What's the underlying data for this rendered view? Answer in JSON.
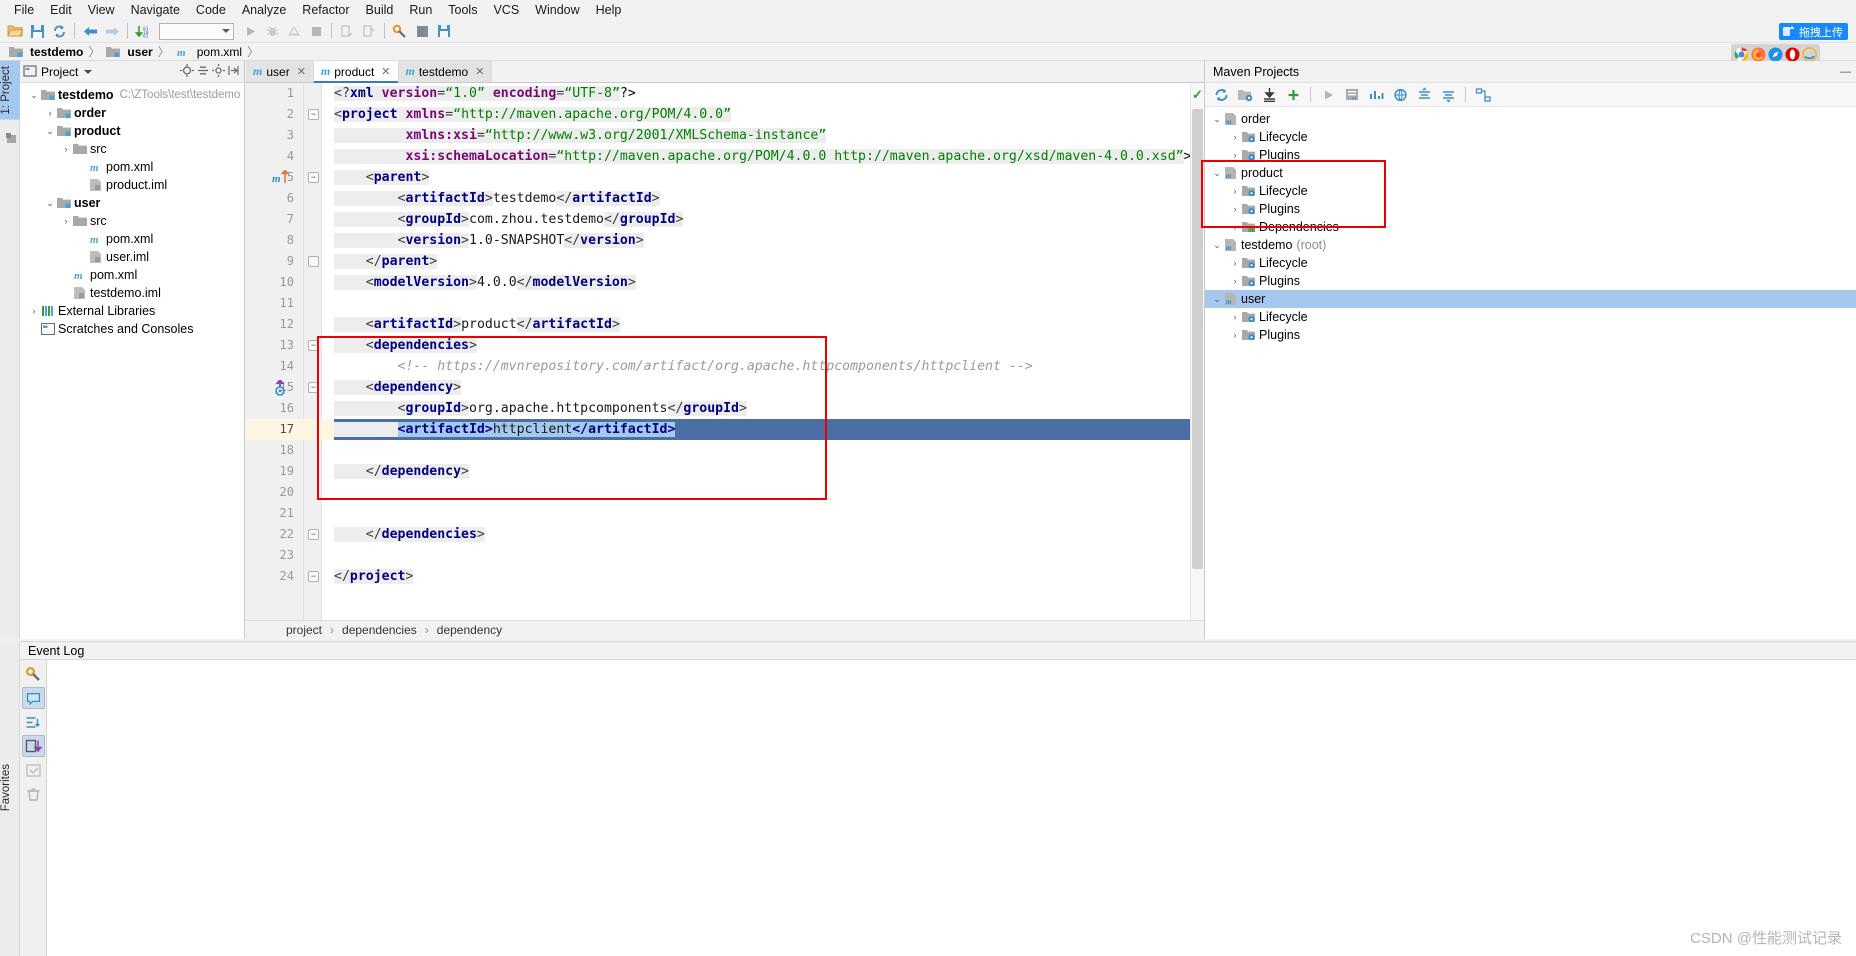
{
  "menu": {
    "items": [
      "File",
      "Edit",
      "View",
      "Navigate",
      "Code",
      "Analyze",
      "Refactor",
      "Build",
      "Run",
      "Tools",
      "VCS",
      "Window",
      "Help"
    ]
  },
  "toolbar": {
    "upload_label": "拖拽上传",
    "combo_value": "",
    "icons": [
      "open-folder-icon",
      "save-icon",
      "sync-icon",
      "back-arrow-icon",
      "forward-arrow-icon",
      "update-project-icon",
      "run-icon",
      "debug-icon",
      "coverage-icon",
      "stop-icon",
      "profile-icon",
      "attach-icon",
      "settings-wrench-icon",
      "project-structure-icon",
      "save-all-icon"
    ]
  },
  "breadcrumb": {
    "items": [
      {
        "label": "testdemo",
        "icon": "module-icon",
        "bold": true
      },
      {
        "label": "user",
        "icon": "module-icon",
        "bold": true
      },
      {
        "label": "pom.xml",
        "icon": "maven-m-icon",
        "bold": false
      }
    ],
    "separator": "〉"
  },
  "left_rail": {
    "tabs": [
      {
        "label": "1: Project",
        "selected": true
      },
      {
        "label": "",
        "selected": false
      }
    ],
    "favorites_label": "Favorites"
  },
  "project_panel": {
    "title": "Project",
    "tree": [
      {
        "depth": 0,
        "arrow": "⌄",
        "icon": "module-icon",
        "label": "testdemo",
        "bold": true,
        "path": "C:\\ZTools\\test\\testdemo"
      },
      {
        "depth": 1,
        "arrow": "›",
        "icon": "module-icon",
        "label": "order",
        "bold": true,
        "path": ""
      },
      {
        "depth": 1,
        "arrow": "⌄",
        "icon": "module-icon",
        "label": "product",
        "bold": true,
        "path": ""
      },
      {
        "depth": 2,
        "arrow": "›",
        "icon": "folder-icon",
        "label": "src",
        "bold": false,
        "path": ""
      },
      {
        "depth": 3,
        "arrow": "",
        "icon": "maven-m-icon",
        "label": "pom.xml",
        "bold": false,
        "path": ""
      },
      {
        "depth": 3,
        "arrow": "",
        "icon": "iml-icon",
        "label": "product.iml",
        "bold": false,
        "path": ""
      },
      {
        "depth": 1,
        "arrow": "⌄",
        "icon": "module-icon",
        "label": "user",
        "bold": true,
        "path": ""
      },
      {
        "depth": 2,
        "arrow": "›",
        "icon": "folder-icon",
        "label": "src",
        "bold": false,
        "path": ""
      },
      {
        "depth": 3,
        "arrow": "",
        "icon": "maven-m-icon",
        "label": "pom.xml",
        "bold": false,
        "path": ""
      },
      {
        "depth": 3,
        "arrow": "",
        "icon": "iml-icon",
        "label": "user.iml",
        "bold": false,
        "path": ""
      },
      {
        "depth": 2,
        "arrow": "",
        "icon": "maven-m-icon",
        "label": "pom.xml",
        "bold": false,
        "path": ""
      },
      {
        "depth": 2,
        "arrow": "",
        "icon": "iml-icon",
        "label": "testdemo.iml",
        "bold": false,
        "path": ""
      },
      {
        "depth": 0,
        "arrow": "›",
        "icon": "libraries-icon",
        "label": "External Libraries",
        "bold": false,
        "path": ""
      },
      {
        "depth": 0,
        "arrow": "",
        "icon": "scratches-icon",
        "label": "Scratches and Consoles",
        "bold": false,
        "path": ""
      }
    ]
  },
  "editor": {
    "tabs": [
      {
        "label": "user",
        "active": false
      },
      {
        "label": "product",
        "active": true
      },
      {
        "label": "testdemo",
        "active": false
      }
    ],
    "browser_icons": [
      "chrome-icon",
      "firefox-icon",
      "safari-icon",
      "opera-icon",
      "edge-ie-icon"
    ],
    "lines": [
      {
        "n": 1,
        "fold": "",
        "tokens": [
          {
            "t": "br",
            "v": "<?"
          },
          {
            "t": "tag",
            "v": "xml"
          },
          {
            "t": "br",
            "v": " "
          },
          {
            "t": "attr",
            "v": "version"
          },
          {
            "t": "br",
            "v": "="
          },
          {
            "t": "val",
            "v": "“1.0”"
          },
          {
            "t": "br",
            "v": " "
          },
          {
            "t": "attr",
            "v": "encoding"
          },
          {
            "t": "br",
            "v": "="
          },
          {
            "t": "val",
            "v": "“UTF-8”"
          },
          {
            "t": "plain",
            "v": "?>"
          }
        ]
      },
      {
        "n": 2,
        "fold": "-",
        "tokens": [
          {
            "t": "br",
            "v": "<"
          },
          {
            "t": "tag",
            "v": "project"
          },
          {
            "t": "br",
            "v": " "
          },
          {
            "t": "attr",
            "v": "xmlns"
          },
          {
            "t": "br",
            "v": "="
          },
          {
            "t": "val",
            "v": "“http://maven.apache.org/POM/4.0.0”"
          }
        ]
      },
      {
        "n": 3,
        "fold": "",
        "tokens": [
          {
            "t": "br",
            "v": "         "
          },
          {
            "t": "attr",
            "v": "xmlns:xsi"
          },
          {
            "t": "br",
            "v": "="
          },
          {
            "t": "val",
            "v": "“http://www.w3.org/2001/XMLSchema-instance”"
          }
        ]
      },
      {
        "n": 4,
        "fold": "",
        "tokens": [
          {
            "t": "br",
            "v": "         "
          },
          {
            "t": "attr",
            "v": "xsi:schemaLocation"
          },
          {
            "t": "br",
            "v": "="
          },
          {
            "t": "val",
            "v": "“http://maven.apache.org/POM/4.0.0 http://maven.apache.org/xsd/maven-4.0.0.xsd”"
          },
          {
            "t": "plain",
            "v": ">"
          }
        ]
      },
      {
        "n": 5,
        "fold": "-",
        "marker": "maven-reimport-icon",
        "tokens": [
          {
            "t": "br",
            "v": "    <"
          },
          {
            "t": "tag",
            "v": "parent"
          },
          {
            "t": "br",
            "v": ">"
          }
        ]
      },
      {
        "n": 6,
        "fold": "",
        "tokens": [
          {
            "t": "br",
            "v": "        <"
          },
          {
            "t": "tag",
            "v": "artifactId"
          },
          {
            "t": "br",
            "v": ">"
          },
          {
            "t": "txt",
            "v": "testdemo"
          },
          {
            "t": "br",
            "v": "</"
          },
          {
            "t": "tag",
            "v": "artifactId"
          },
          {
            "t": "br",
            "v": ">"
          }
        ]
      },
      {
        "n": 7,
        "fold": "",
        "tokens": [
          {
            "t": "br",
            "v": "        <"
          },
          {
            "t": "tag",
            "v": "groupId"
          },
          {
            "t": "br",
            "v": ">"
          },
          {
            "t": "txt",
            "v": "com.zhou.testdemo"
          },
          {
            "t": "br",
            "v": "</"
          },
          {
            "t": "tag",
            "v": "groupId"
          },
          {
            "t": "br",
            "v": ">"
          }
        ]
      },
      {
        "n": 8,
        "fold": "",
        "tokens": [
          {
            "t": "br",
            "v": "        <"
          },
          {
            "t": "tag",
            "v": "version"
          },
          {
            "t": "br",
            "v": ">"
          },
          {
            "t": "txt",
            "v": "1.0-SNAPSHOT"
          },
          {
            "t": "br",
            "v": "</"
          },
          {
            "t": "tag",
            "v": "version"
          },
          {
            "t": "br",
            "v": ">"
          }
        ]
      },
      {
        "n": 9,
        "fold": "o",
        "tokens": [
          {
            "t": "br",
            "v": "    </"
          },
          {
            "t": "tag",
            "v": "parent"
          },
          {
            "t": "br",
            "v": ">"
          }
        ]
      },
      {
        "n": 10,
        "fold": "",
        "tokens": [
          {
            "t": "br",
            "v": "    <"
          },
          {
            "t": "tag",
            "v": "modelVersion"
          },
          {
            "t": "br",
            "v": ">"
          },
          {
            "t": "txt",
            "v": "4.0.0"
          },
          {
            "t": "br",
            "v": "</"
          },
          {
            "t": "tag",
            "v": "modelVersion"
          },
          {
            "t": "br",
            "v": ">"
          }
        ]
      },
      {
        "n": 11,
        "fold": "",
        "tokens": []
      },
      {
        "n": 12,
        "fold": "",
        "tokens": [
          {
            "t": "br",
            "v": "    <"
          },
          {
            "t": "tag",
            "v": "artifactId"
          },
          {
            "t": "br",
            "v": ">"
          },
          {
            "t": "txt",
            "v": "product"
          },
          {
            "t": "br",
            "v": "</"
          },
          {
            "t": "tag",
            "v": "artifactId"
          },
          {
            "t": "br",
            "v": ">"
          }
        ]
      },
      {
        "n": 13,
        "fold": "-",
        "tokens": [
          {
            "t": "br",
            "v": "    <"
          },
          {
            "t": "tag",
            "v": "dependencies"
          },
          {
            "t": "br",
            "v": ">"
          }
        ]
      },
      {
        "n": 14,
        "fold": "",
        "tokens": [
          {
            "t": "cmt",
            "v": "        <!-- https://mvnrepository.com/artifact/org.apache.httpcomponents/httpclient -->"
          }
        ]
      },
      {
        "n": 15,
        "fold": "-",
        "marker": "dependency-arrow-icon",
        "tokens": [
          {
            "t": "br",
            "v": "    <"
          },
          {
            "t": "tag",
            "v": "dependency"
          },
          {
            "t": "br",
            "v": ">"
          }
        ]
      },
      {
        "n": 16,
        "fold": "",
        "tokens": [
          {
            "t": "br",
            "v": "        <"
          },
          {
            "t": "tag",
            "v": "groupId"
          },
          {
            "t": "br",
            "v": ">"
          },
          {
            "t": "txt",
            "v": "org.apache.httpcomponents"
          },
          {
            "t": "br",
            "v": "</"
          },
          {
            "t": "tag",
            "v": "groupId"
          },
          {
            "t": "br",
            "v": ">"
          }
        ]
      },
      {
        "n": 17,
        "fold": "",
        "highlight": true,
        "selection": true,
        "tokens": [
          {
            "t": "br",
            "v": "        "
          },
          {
            "t": "seltag",
            "v": "<artifactId>"
          },
          {
            "t": "seltxt",
            "v": "httpclient"
          },
          {
            "t": "seltag",
            "v": "</artifactId>"
          }
        ]
      },
      {
        "n": 18,
        "fold": "",
        "tokens": []
      },
      {
        "n": 19,
        "fold": "",
        "tokens": [
          {
            "t": "br",
            "v": "    </"
          },
          {
            "t": "tag",
            "v": "dependency"
          },
          {
            "t": "br",
            "v": ">"
          }
        ]
      },
      {
        "n": 20,
        "fold": "",
        "tokens": []
      },
      {
        "n": 21,
        "fold": "",
        "tokens": []
      },
      {
        "n": 22,
        "fold": "-",
        "tokens": [
          {
            "t": "br",
            "v": "    </"
          },
          {
            "t": "tag",
            "v": "dependencies"
          },
          {
            "t": "br",
            "v": ">"
          }
        ]
      },
      {
        "n": 23,
        "fold": "",
        "tokens": []
      },
      {
        "n": 24,
        "fold": "-",
        "tokens": [
          {
            "t": "br",
            "v": "</"
          },
          {
            "t": "tag",
            "v": "project"
          },
          {
            "t": "br",
            "v": ">"
          }
        ]
      }
    ],
    "breadcrumb_bottom": [
      "project",
      "dependencies",
      "dependency"
    ],
    "breadcrumb_sep": "›"
  },
  "maven_panel": {
    "title": "Maven Projects",
    "toolbar_icons": [
      "reimport-icon",
      "generate-sources-icon",
      "download-sources-icon",
      "add-maven-project-icon",
      "run-icon",
      "execute-goal-icon",
      "toggle-skip-tests-icon",
      "toggle-offline-icon",
      "collapse-all-icon",
      "expand-all-icon",
      "show-diagram-icon"
    ],
    "tree": [
      {
        "depth": 0,
        "arrow": "⌄",
        "icon": "maven-module-icon",
        "label": "order",
        "suffix": "",
        "selected": false
      },
      {
        "depth": 1,
        "arrow": "›",
        "icon": "lifecycle-icon",
        "label": "Lifecycle",
        "suffix": "",
        "selected": false
      },
      {
        "depth": 1,
        "arrow": "›",
        "icon": "plugins-icon",
        "label": "Plugins",
        "suffix": "",
        "selected": false
      },
      {
        "depth": 0,
        "arrow": "⌄",
        "icon": "maven-module-icon",
        "label": "product",
        "suffix": "",
        "selected": false
      },
      {
        "depth": 1,
        "arrow": "›",
        "icon": "lifecycle-icon",
        "label": "Lifecycle",
        "suffix": "",
        "selected": false
      },
      {
        "depth": 1,
        "arrow": "›",
        "icon": "plugins-icon",
        "label": "Plugins",
        "suffix": "",
        "selected": false
      },
      {
        "depth": 1,
        "arrow": "›",
        "icon": "dependencies-icon",
        "label": "Dependencies",
        "suffix": "",
        "selected": false
      },
      {
        "depth": 0,
        "arrow": "⌄",
        "icon": "maven-module-icon",
        "label": "testdemo",
        "suffix": "(root)",
        "selected": false
      },
      {
        "depth": 1,
        "arrow": "›",
        "icon": "lifecycle-icon",
        "label": "Lifecycle",
        "suffix": "",
        "selected": false
      },
      {
        "depth": 1,
        "arrow": "›",
        "icon": "plugins-icon",
        "label": "Plugins",
        "suffix": "",
        "selected": false
      },
      {
        "depth": 0,
        "arrow": "⌄",
        "icon": "maven-module-icon",
        "label": "user",
        "suffix": "",
        "selected": true
      },
      {
        "depth": 1,
        "arrow": "›",
        "icon": "lifecycle-icon",
        "label": "Lifecycle",
        "suffix": "",
        "selected": false
      },
      {
        "depth": 1,
        "arrow": "›",
        "icon": "plugins-icon",
        "label": "Plugins",
        "suffix": "",
        "selected": false
      }
    ]
  },
  "event_log": {
    "title": "Event Log",
    "rail_icons": [
      "settings-wrench-icon",
      "balloon-notification-icon",
      "expand-collapse-icon",
      "scroll-to-end-icon",
      "mark-read-icon",
      "trash-icon"
    ]
  },
  "watermark": "CSDN @性能测试记录",
  "colors": {
    "accent_blue": "#1989fa",
    "tab_underline": "#3b78c3",
    "annotation_red": "#ee0000",
    "selection_blue": "#4a6fa5",
    "selection_light": "#a5c8ef",
    "caret_line": "#fdf6e3",
    "xml_tag": "#000080",
    "xml_attr": "#7a0874",
    "xml_value": "#008000",
    "xml_comment": "#9a9a9a"
  }
}
